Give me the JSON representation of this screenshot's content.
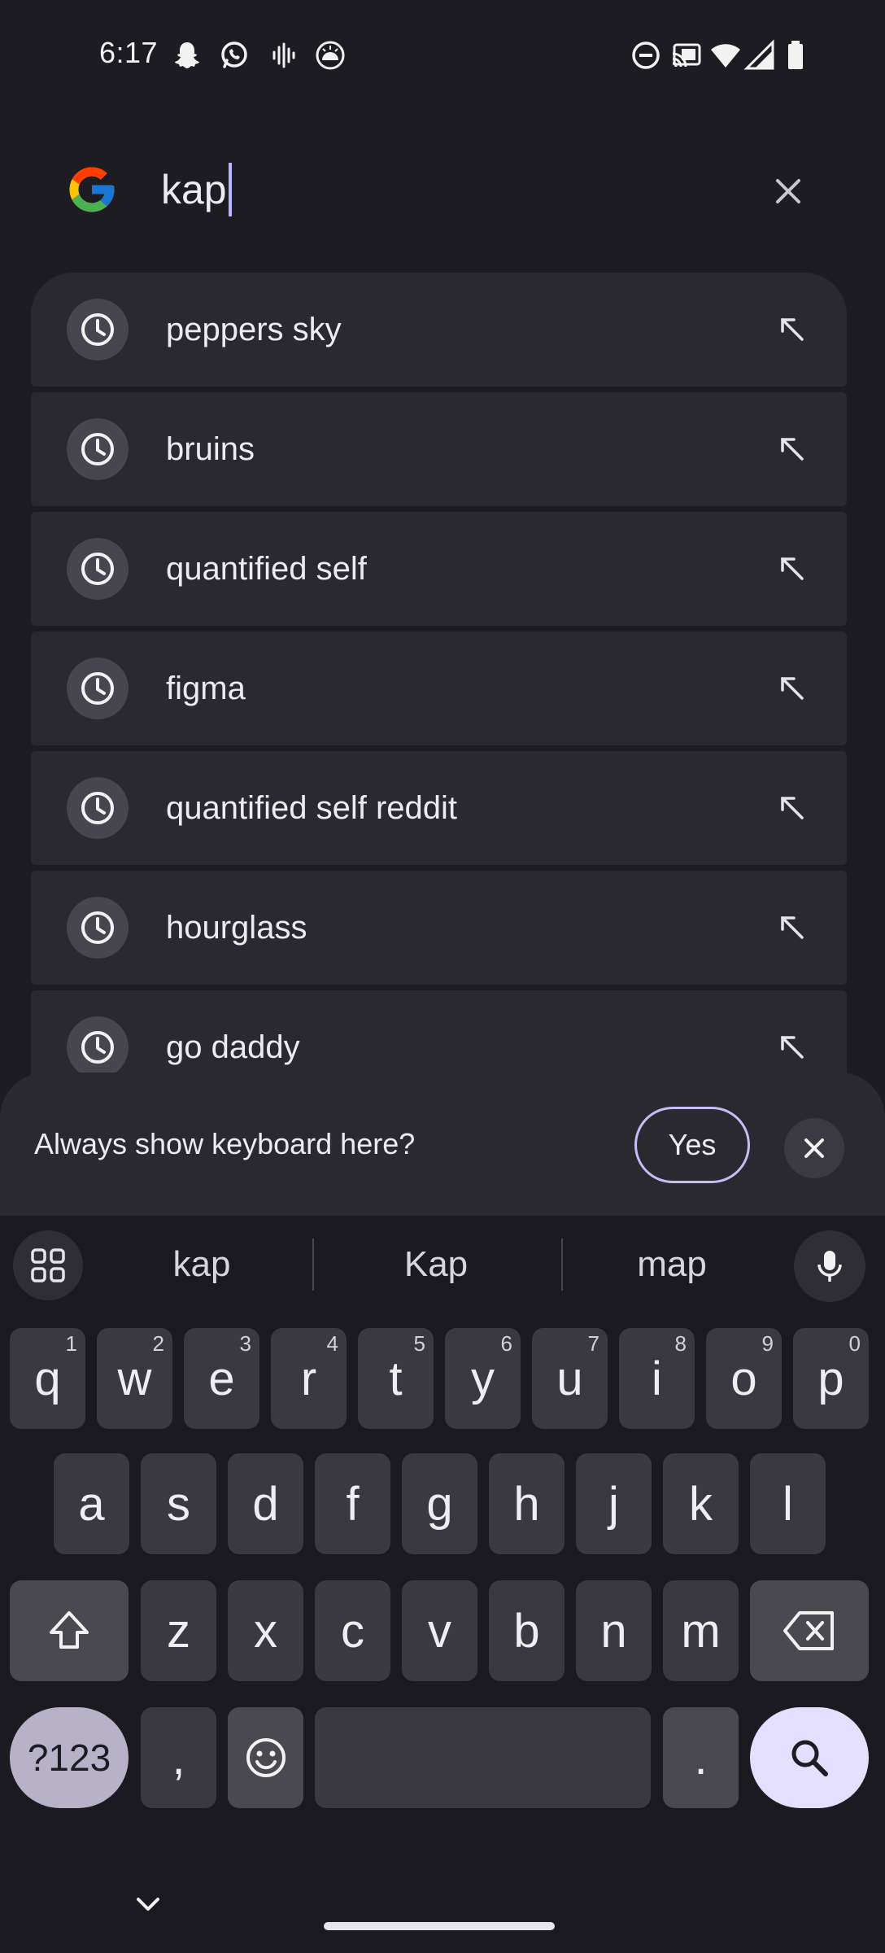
{
  "status_bar": {
    "time": "6:17",
    "left_icons": [
      "snapchat-icon",
      "whatsapp-icon",
      "voice-wave-icon",
      "sunrise-icon"
    ],
    "right_icons": [
      "do-not-disturb-icon",
      "cast-icon",
      "wifi-icon",
      "signal-icon",
      "battery-icon"
    ]
  },
  "search": {
    "query": "kap",
    "logo": "google-logo",
    "clear_icon": "close-icon"
  },
  "suggestions": [
    {
      "text": "peppers sky",
      "icon": "history-clock-icon",
      "action_icon": "fill-arrow-icon"
    },
    {
      "text": "bruins",
      "icon": "history-clock-icon",
      "action_icon": "fill-arrow-icon"
    },
    {
      "text": "quantified self",
      "icon": "history-clock-icon",
      "action_icon": "fill-arrow-icon"
    },
    {
      "text": "figma",
      "icon": "history-clock-icon",
      "action_icon": "fill-arrow-icon"
    },
    {
      "text": "quantified self reddit",
      "icon": "history-clock-icon",
      "action_icon": "fill-arrow-icon"
    },
    {
      "text": "hourglass",
      "icon": "history-clock-icon",
      "action_icon": "fill-arrow-icon"
    },
    {
      "text": "go daddy",
      "icon": "history-clock-icon",
      "action_icon": "fill-arrow-icon"
    }
  ],
  "keyboard_prompt": {
    "question": "Always show keyboard here?",
    "yes_label": "Yes"
  },
  "keyboard": {
    "word_suggestions": [
      "kap",
      "Kap",
      "map"
    ],
    "row1": [
      {
        "key": "q",
        "hint": "1"
      },
      {
        "key": "w",
        "hint": "2"
      },
      {
        "key": "e",
        "hint": "3"
      },
      {
        "key": "r",
        "hint": "4"
      },
      {
        "key": "t",
        "hint": "5"
      },
      {
        "key": "y",
        "hint": "6"
      },
      {
        "key": "u",
        "hint": "7"
      },
      {
        "key": "i",
        "hint": "8"
      },
      {
        "key": "o",
        "hint": "9"
      },
      {
        "key": "p",
        "hint": "0"
      }
    ],
    "row2": [
      "a",
      "s",
      "d",
      "f",
      "g",
      "h",
      "j",
      "k",
      "l"
    ],
    "row3": [
      "z",
      "x",
      "c",
      "v",
      "b",
      "n",
      "m"
    ],
    "symbols_label": "?123",
    "comma": ",",
    "period": "."
  },
  "colors": {
    "background": "#1d1c22",
    "card": "#2a2930",
    "key": "#3a393f",
    "accent": "#b9b4ff",
    "search_key": "#e4dfff"
  }
}
